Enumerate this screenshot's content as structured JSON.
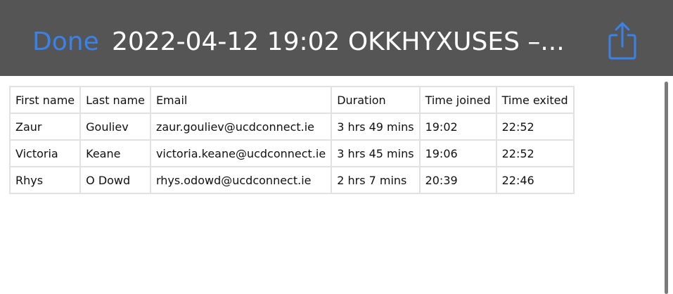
{
  "header": {
    "done_label": "Done",
    "title": "2022-04-12 19:02 OKKHYXUSES –...",
    "share_icon": "share-icon"
  },
  "colors": {
    "header_bg": "#555555",
    "accent": "#3b82e8"
  },
  "table": {
    "columns": [
      "First name",
      "Last name",
      "Email",
      "Duration",
      "Time joined",
      "Time exited"
    ],
    "rows": [
      [
        "Zaur",
        "Gouliev",
        "zaur.gouliev@ucdconnect.ie",
        "3 hrs 49 mins",
        "19:02",
        "22:52"
      ],
      [
        "Victoria",
        "Keane",
        "victoria.keane@ucdconnect.ie",
        "3 hrs 45 mins",
        "19:06",
        "22:52"
      ],
      [
        "Rhys",
        "O Dowd",
        "rhys.odowd@ucdconnect.ie",
        "2 hrs 7 mins",
        "20:39",
        "22:46"
      ]
    ]
  }
}
